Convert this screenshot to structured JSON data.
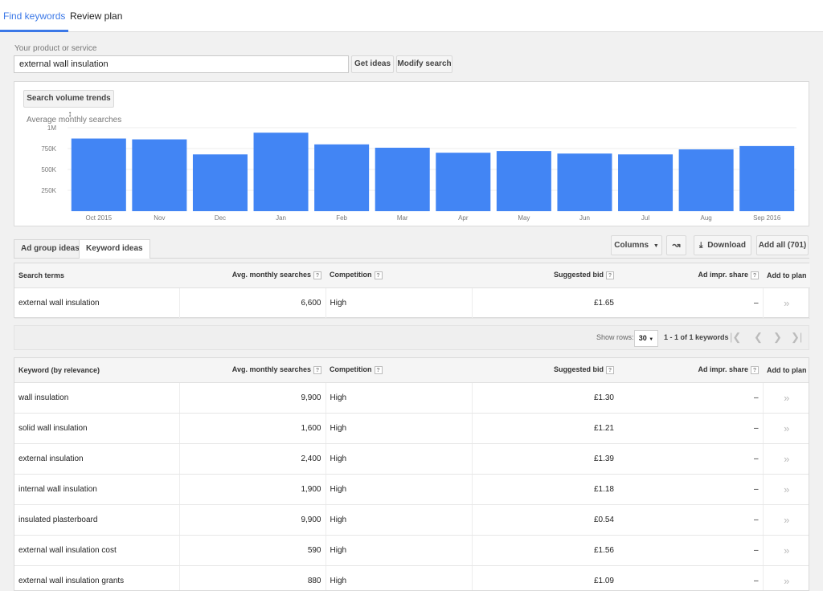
{
  "top_tabs": {
    "find_keywords": "Find keywords",
    "review_plan": "Review plan"
  },
  "product": {
    "label": "Your product or service",
    "value": "external wall insulation",
    "get_ideas": "Get ideas",
    "modify_search": "Modify search"
  },
  "chart": {
    "selector_label": "Search volume trends",
    "subtitle": "Average monthly searches",
    "y_ticks": [
      "1M",
      "750K",
      "500K",
      "250K"
    ]
  },
  "chart_data": {
    "type": "bar",
    "title": "",
    "ylabel": "Average monthly searches",
    "categories": [
      "Oct 2015",
      "Nov",
      "Dec",
      "Jan",
      "Feb",
      "Mar",
      "Apr",
      "May",
      "Jun",
      "Jul",
      "Aug",
      "Sep 2016"
    ],
    "values": [
      870000,
      860000,
      680000,
      940000,
      800000,
      760000,
      700000,
      720000,
      690000,
      680000,
      740000,
      780000
    ],
    "ylim": [
      0,
      1000000
    ],
    "grid": true,
    "colors": {
      "bar": "#4285f4"
    }
  },
  "idea_tabs": {
    "ad_group": "Ad group ideas",
    "keyword": "Keyword ideas"
  },
  "toolbar": {
    "columns": "Columns",
    "download": "Download",
    "add_all": "Add all (701)"
  },
  "search_terms_table": {
    "headers": {
      "term": "Search terms",
      "avg": "Avg. monthly searches",
      "competition": "Competition",
      "bid": "Suggested bid",
      "impr": "Ad impr. share",
      "add": "Add to plan"
    },
    "rows": [
      {
        "keyword": "external wall insulation",
        "avg": "6,600",
        "competition": "High",
        "bid": "£1.65",
        "impr": "–"
      }
    ]
  },
  "pagination": {
    "show_rows_label": "Show rows:",
    "rows_value": "30",
    "range": "1 - 1 of 1 keywords"
  },
  "keyword_table": {
    "headers": {
      "term": "Keyword (by relevance)",
      "avg": "Avg. monthly searches",
      "competition": "Competition",
      "bid": "Suggested bid",
      "impr": "Ad impr. share",
      "add": "Add to plan"
    },
    "rows": [
      {
        "keyword": "wall insulation",
        "avg": "9,900",
        "competition": "High",
        "bid": "£1.30",
        "impr": "–"
      },
      {
        "keyword": "solid wall insulation",
        "avg": "1,600",
        "competition": "High",
        "bid": "£1.21",
        "impr": "–"
      },
      {
        "keyword": "external insulation",
        "avg": "2,400",
        "competition": "High",
        "bid": "£1.39",
        "impr": "–"
      },
      {
        "keyword": "internal wall insulation",
        "avg": "1,900",
        "competition": "High",
        "bid": "£1.18",
        "impr": "–"
      },
      {
        "keyword": "insulated plasterboard",
        "avg": "9,900",
        "competition": "High",
        "bid": "£0.54",
        "impr": "–"
      },
      {
        "keyword": "external wall insulation cost",
        "avg": "590",
        "competition": "High",
        "bid": "£1.56",
        "impr": "–"
      },
      {
        "keyword": "external wall insulation grants",
        "avg": "880",
        "competition": "High",
        "bid": "£1.09",
        "impr": "–"
      }
    ]
  }
}
